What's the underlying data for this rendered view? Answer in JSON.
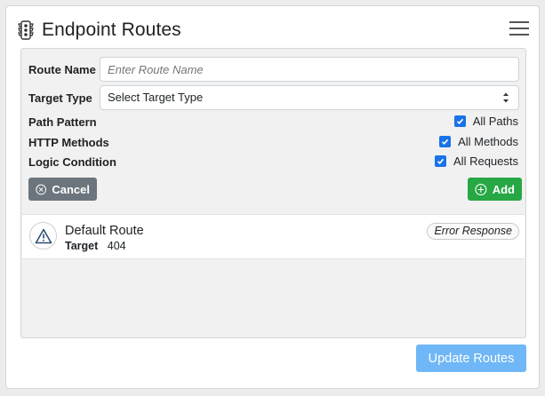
{
  "header": {
    "title": "Endpoint Routes",
    "icon": "traffic-light-icon",
    "menu_icon": "hamburger-menu-icon"
  },
  "form": {
    "route_name": {
      "label": "Route Name",
      "placeholder": "Enter Route Name",
      "value": ""
    },
    "target_type": {
      "label": "Target Type",
      "value": "Select Target Type"
    },
    "path_pattern": {
      "label": "Path Pattern",
      "check_label": "All Paths",
      "checked": true
    },
    "http_methods": {
      "label": "HTTP Methods",
      "check_label": "All Methods",
      "checked": true
    },
    "logic_condition": {
      "label": "Logic Condition",
      "check_label": "All Requests",
      "checked": true
    },
    "cancel_label": "Cancel",
    "add_label": "Add"
  },
  "routes": [
    {
      "name": "Default Route",
      "target_label": "Target",
      "target_value": "404",
      "badge": "Error Response",
      "icon": "warning-icon"
    }
  ],
  "footer": {
    "update_label": "Update Routes"
  },
  "colors": {
    "primary": "#1a73e8",
    "success": "#28a745",
    "secondary": "#6c757d",
    "update": "#6fb7f6"
  }
}
